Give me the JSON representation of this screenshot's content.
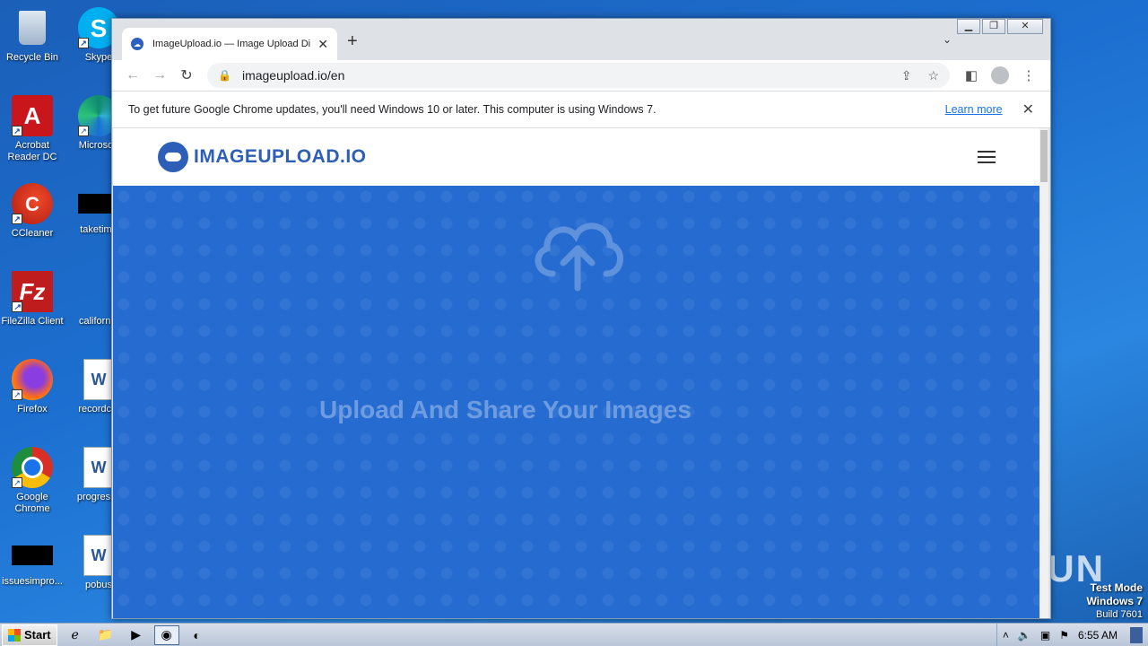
{
  "desktop": {
    "icons": [
      {
        "label": "Recycle Bin"
      },
      {
        "label": "Skype"
      },
      {
        "label": "Acrobat Reader DC"
      },
      {
        "label": "Microsoft"
      },
      {
        "label": "CCleaner"
      },
      {
        "label": "taketime"
      },
      {
        "label": "FileZilla Client"
      },
      {
        "label": "california"
      },
      {
        "label": "Firefox"
      },
      {
        "label": "recordclo"
      },
      {
        "label": "Google Chrome"
      },
      {
        "label": "progressc"
      },
      {
        "label": "issuesimpro..."
      },
      {
        "label": "pobus"
      }
    ],
    "watermark": "ANY RUN",
    "test_mode": {
      "line1": "Test Mode",
      "line2": "Windows 7",
      "line3": "Build 7601"
    }
  },
  "browser": {
    "tab": {
      "title": "ImageUpload.io — Image Upload Di"
    },
    "url": "imageupload.io/en",
    "infobar": {
      "message": "To get future Google Chrome updates, you'll need Windows 10 or later. This computer is using Windows 7.",
      "link": "Learn more"
    }
  },
  "site": {
    "logo_text": "IMAGEUPLOAD.IO",
    "hero_title": "Upload And Share Your Images"
  },
  "taskbar": {
    "start_label": "Start",
    "clock": "6:55 AM"
  }
}
